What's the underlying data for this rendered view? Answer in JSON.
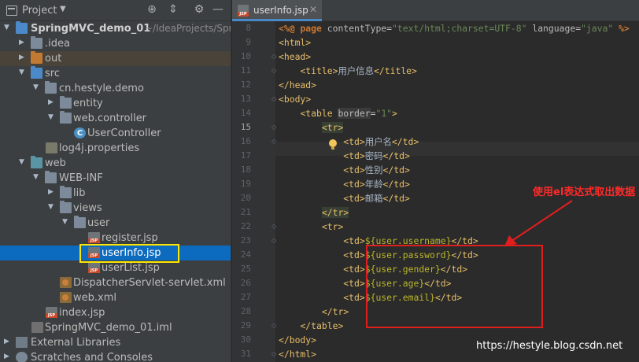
{
  "project_panel": {
    "title": "Project",
    "toolbar_icons": [
      "locate-icon",
      "collapse-icon",
      "gear-icon",
      "hide-icon"
    ]
  },
  "tree": [
    {
      "label": "SpringMVC_demo_01",
      "hint": "~/IdeaProjects/Spr",
      "icon": "module-folder-icon"
    },
    {
      "label": ".idea",
      "icon": "folder-icon"
    },
    {
      "label": "out",
      "icon": "folder-icon"
    },
    {
      "label": "src",
      "icon": "folder-icon"
    },
    {
      "label": "cn.hestyle.demo",
      "icon": "package-icon"
    },
    {
      "label": "entity",
      "icon": "package-icon"
    },
    {
      "label": "web.controller",
      "icon": "package-icon"
    },
    {
      "label": "UserController",
      "icon": "class-icon"
    },
    {
      "label": "log4j.properties",
      "icon": "properties-file-icon"
    },
    {
      "label": "web",
      "icon": "web-folder-icon"
    },
    {
      "label": "WEB-INF",
      "icon": "folder-icon"
    },
    {
      "label": "lib",
      "icon": "folder-icon"
    },
    {
      "label": "views",
      "icon": "folder-icon"
    },
    {
      "label": "user",
      "icon": "folder-icon"
    },
    {
      "label": "register.jsp",
      "icon": "jsp-file-icon"
    },
    {
      "label": "userInfo.jsp",
      "icon": "jsp-file-icon"
    },
    {
      "label": "userList.jsp",
      "icon": "jsp-file-icon"
    },
    {
      "label": "DispatcherServlet-servlet.xml",
      "icon": "spring-xml-icon"
    },
    {
      "label": "web.xml",
      "icon": "xml-file-icon"
    },
    {
      "label": "index.jsp",
      "icon": "jsp-file-icon"
    },
    {
      "label": "SpringMVC_demo_01.iml",
      "icon": "iml-file-icon"
    },
    {
      "label": "External Libraries",
      "icon": "library-icon"
    },
    {
      "label": "Scratches and Consoles",
      "icon": "scratches-icon"
    }
  ],
  "editor": {
    "tab_label": "userInfo.jsp",
    "current_line": 15
  },
  "code_lines": [
    {
      "n": "8"
    },
    {
      "n": "9"
    },
    {
      "n": "10"
    },
    {
      "n": "11"
    },
    {
      "n": "12"
    },
    {
      "n": "13"
    },
    {
      "n": "14"
    },
    {
      "n": "15"
    },
    {
      "n": "16"
    },
    {
      "n": "17"
    },
    {
      "n": "18"
    },
    {
      "n": "19"
    },
    {
      "n": "20"
    },
    {
      "n": "21"
    },
    {
      "n": "22"
    },
    {
      "n": "23"
    },
    {
      "n": "24"
    },
    {
      "n": "25"
    },
    {
      "n": "26"
    },
    {
      "n": "27"
    },
    {
      "n": "28"
    },
    {
      "n": "29"
    },
    {
      "n": "30"
    },
    {
      "n": "31"
    }
  ],
  "code": {
    "l8": {
      "a": "<%@ ",
      "b": "page",
      "c": " contentType=",
      "d": "\"text/html;charset=UTF-8\"",
      "e": " language=",
      "f": "\"java\"",
      "g": " %>"
    },
    "l9": "<html>",
    "l10": "<head>",
    "l11": {
      "a": "<title>",
      "b": "用户信息",
      "c": "</title>"
    },
    "l12": "</head>",
    "l13": "<body>",
    "l14": {
      "a": "<table ",
      "b": "border",
      "c": "=",
      "d": "\"1\"",
      "e": ">"
    },
    "l15": "<tr>",
    "l16": {
      "a": "<td>",
      "b": "用户名",
      "c": "</td>"
    },
    "l17": {
      "a": "<td>",
      "b": "密码",
      "c": "</td>"
    },
    "l18": {
      "a": "<td>",
      "b": "性别",
      "c": "</td>"
    },
    "l19": {
      "a": "<td>",
      "b": "年龄",
      "c": "</td>"
    },
    "l20": {
      "a": "<td>",
      "b": "邮箱",
      "c": "</td>"
    },
    "l21": "</tr>",
    "l22": "<tr>",
    "l23": {
      "a": "<td>",
      "b": "${",
      "c": "user.username",
      "d": "}",
      "e": "</td>"
    },
    "l24": {
      "a": "<td>",
      "b": "${",
      "c": "user.password",
      "d": "}",
      "e": "</td>"
    },
    "l25": {
      "a": "<td>",
      "b": "${",
      "c": "user.gender",
      "d": "}",
      "e": "</td>"
    },
    "l26": {
      "a": "<td>",
      "b": "${",
      "c": "user.age",
      "d": "}",
      "e": "</td>"
    },
    "l27": {
      "a": "<td>",
      "b": "${",
      "c": "user.email",
      "d": "}",
      "e": "</td>"
    },
    "l28": "</tr>",
    "l29": "</table>",
    "l30": "</body>",
    "l31": "</html>"
  },
  "annotation": {
    "text": "使用el表达式取出数据",
    "color": "#e01e1e"
  },
  "highlight_color": "#ffe600",
  "watermark": "https://hestyle.blog.csdn.net"
}
